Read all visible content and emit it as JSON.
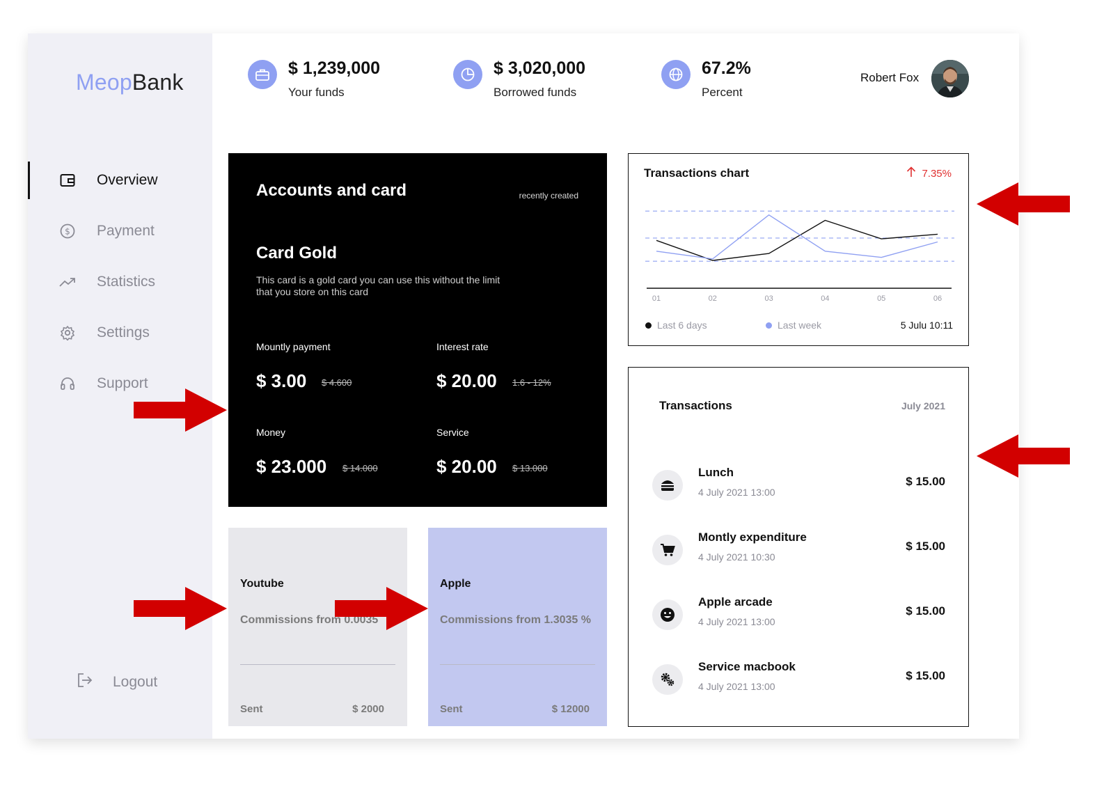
{
  "brand": {
    "part1": "Meop",
    "part2": "Bank"
  },
  "nav": {
    "items": [
      {
        "label": "Overview",
        "icon": "wallet-icon",
        "active": true
      },
      {
        "label": "Payment",
        "icon": "dollar-circle-icon"
      },
      {
        "label": "Statistics",
        "icon": "trending-up-icon"
      },
      {
        "label": "Settings",
        "icon": "gear-icon"
      },
      {
        "label": "Support",
        "icon": "headset-icon"
      }
    ],
    "logout": "Logout"
  },
  "header": {
    "stats": [
      {
        "value": "$ 1,239,000",
        "label": "Your funds",
        "icon": "briefcase-icon"
      },
      {
        "value": "$ 3,020,000",
        "label": "Borrowed funds",
        "icon": "pie-chart-icon"
      },
      {
        "value": "67.2%",
        "label": "Percent",
        "icon": "globe-icon"
      }
    ],
    "user_name": "Robert Fox"
  },
  "accounts": {
    "title": "Accounts and card",
    "recent": "recently created",
    "card_name": "Card Gold",
    "description": "This card is a gold card you can use this without the limit that you store on this card",
    "monthly_label": "Mountly payment",
    "monthly_value": "$ 3.00",
    "monthly_old": "$ 4.600",
    "interest_label": "Interest rate",
    "interest_value": "$ 20.00",
    "interest_old": "1.6 - 12%",
    "money_label": "Money",
    "money_value": "$ 23.000",
    "money_old": "$ 14.000",
    "service_label": "Service",
    "service_value": "$ 20.00",
    "service_old": "$ 13.000"
  },
  "subscriptions": [
    {
      "name": "Youtube",
      "commission": "Commissions from 0.0035",
      "sent_label": "Sent",
      "amount": "$ 2000",
      "color": "#e8e8ec"
    },
    {
      "name": "Apple",
      "commission": "Commissions from 1.3035 %",
      "sent_label": "Sent",
      "amount": "$ 12000",
      "color": "#c2c8f0"
    }
  ],
  "chart_panel": {
    "title": "Transactions chart",
    "change": "7.35%",
    "legend": [
      "Last 6 days",
      "Last week"
    ],
    "date": "5 Julu 10:11"
  },
  "chart_data": {
    "type": "line",
    "categories": [
      "01",
      "02",
      "03",
      "04",
      "05",
      "06"
    ],
    "series": [
      {
        "name": "Last 6 days",
        "color": "#111111",
        "values": [
          62,
          36,
          45,
          88,
          64,
          70
        ]
      },
      {
        "name": "Last week",
        "color": "#8fa0f2",
        "values": [
          48,
          38,
          95,
          48,
          40,
          60
        ]
      }
    ],
    "ylim": [
      0,
      120
    ],
    "grid": true,
    "gridlines": [
      100,
      65,
      35
    ]
  },
  "transactions": {
    "title": "Transactions",
    "month": "July 2021",
    "items": [
      {
        "title": "Lunch",
        "date": "4 July 2021 13:00",
        "amount": "$ 15.00",
        "icon": "burger-icon"
      },
      {
        "title": "Montly expenditure",
        "date": "4 July 2021 10:30",
        "amount": "$ 15.00",
        "icon": "cart-icon"
      },
      {
        "title": "Apple arcade",
        "date": "4 July 2021 13:00",
        "amount": "$ 15.00",
        "icon": "smiley-icon"
      },
      {
        "title": "Service macbook",
        "date": "4 July 2021 13:00",
        "amount": "$ 15.00",
        "icon": "gears-icon"
      }
    ]
  },
  "colors": {
    "accent": "#8fa0f2",
    "arrow": "#d20000",
    "sidebar": "#f0f0f6",
    "positive_change": "#e03030"
  }
}
